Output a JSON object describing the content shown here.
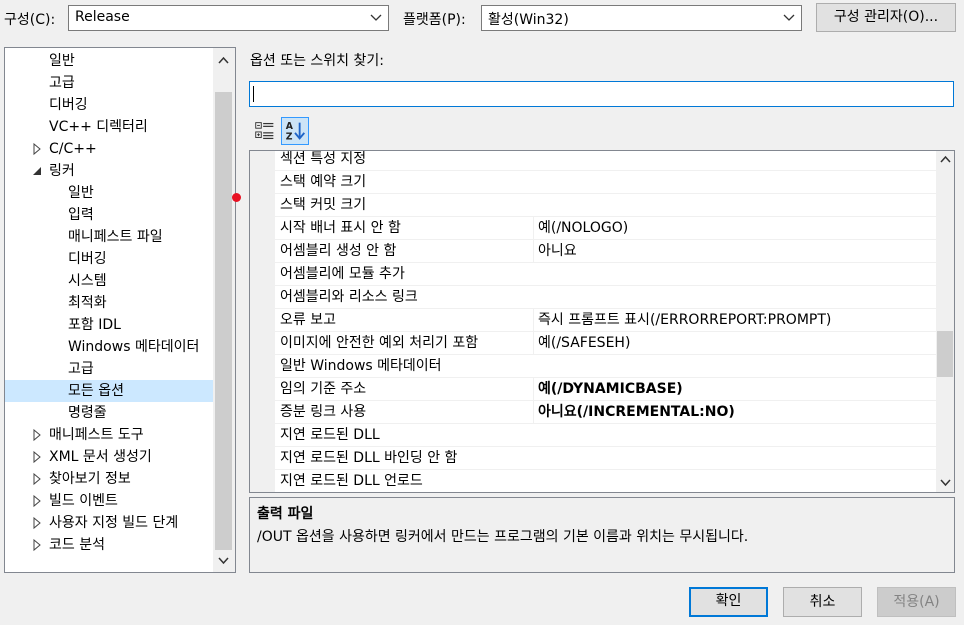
{
  "toolbar": {
    "config_label": "구성(C):",
    "config_value": "Release",
    "platform_label": "플랫폼(P):",
    "platform_value": "활성(Win32)",
    "config_manager_label": "구성 관리자(O)..."
  },
  "tree": {
    "items": [
      {
        "label": "일반"
      },
      {
        "label": "고급"
      },
      {
        "label": "디버깅"
      },
      {
        "label": "VC++ 디렉터리"
      },
      {
        "label": "C/C++"
      },
      {
        "label": "링커"
      },
      {
        "label": "일반"
      },
      {
        "label": "입력"
      },
      {
        "label": "매니페스트 파일"
      },
      {
        "label": "디버깅"
      },
      {
        "label": "시스템"
      },
      {
        "label": "최적화"
      },
      {
        "label": "포함 IDL"
      },
      {
        "label": "Windows 메타데이터"
      },
      {
        "label": "고급"
      },
      {
        "label": "모든 옵션"
      },
      {
        "label": "명령줄"
      },
      {
        "label": "매니페스트 도구"
      },
      {
        "label": "XML 문서 생성기"
      },
      {
        "label": "찾아보기 정보"
      },
      {
        "label": "빌드 이벤트"
      },
      {
        "label": "사용자 지정 빌드 단계"
      },
      {
        "label": "코드 분석"
      }
    ],
    "selected": "모든 옵션"
  },
  "search": {
    "label": "옵션 또는 스위치 찾기:",
    "value": ""
  },
  "grid": {
    "rows": [
      {
        "name": "섹션 특성 지정",
        "value": ""
      },
      {
        "name": "스택 예약 크기",
        "value": ""
      },
      {
        "name": "스택 커밋 크기",
        "value": ""
      },
      {
        "name": "시작 배너 표시 안 함",
        "value": "예(/NOLOGO)"
      },
      {
        "name": "어셈블리 생성 안 함",
        "value": "아니요"
      },
      {
        "name": "어셈블리에 모듈 추가",
        "value": ""
      },
      {
        "name": "어셈블리와 리소스 링크",
        "value": ""
      },
      {
        "name": "오류 보고",
        "value": "즉시 프롬프트 표시(/ERRORREPORT:PROMPT)"
      },
      {
        "name": "이미지에 안전한 예외 처리기 포함",
        "value": "예(/SAFESEH)"
      },
      {
        "name": "일반 Windows 메타데이터",
        "value": ""
      },
      {
        "name": "임의 기준 주소",
        "value": "예(/DYNAMICBASE)"
      },
      {
        "name": "증분 링크 사용",
        "value": "아니요(/INCREMENTAL:NO)"
      },
      {
        "name": "지연 로드된 DLL",
        "value": ""
      },
      {
        "name": "지연 로드된 DLL 바인딩 안 함",
        "value": ""
      },
      {
        "name": "지연 로드된 DLL 언로드",
        "value": ""
      }
    ]
  },
  "description": {
    "title": "출력 파일",
    "text": "/OUT 옵션을 사용하면 링커에서 만드는 프로그램의 기본 이름과 위치는 무시됩니다."
  },
  "buttons": {
    "ok": "확인",
    "cancel": "취소",
    "apply": "적용(A)"
  },
  "colors": {
    "accent": "#0078d7",
    "selection": "#cce8ff",
    "marker": "#e81123"
  }
}
